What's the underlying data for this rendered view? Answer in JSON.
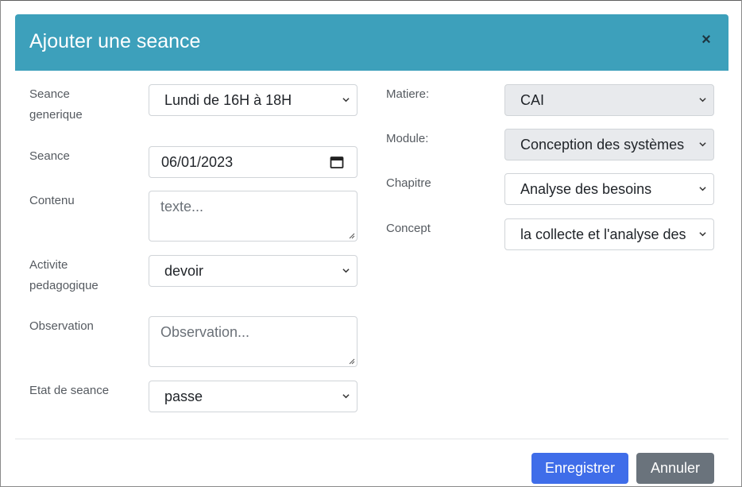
{
  "modal": {
    "title": "Ajouter une seance",
    "close": "×"
  },
  "left": {
    "seance_generique": {
      "label_line1": "Seance",
      "label_line2": "generique",
      "value": "Lundi de 16H à 18H"
    },
    "seance": {
      "label": "Seance",
      "value": "06/01/2023"
    },
    "contenu": {
      "label": "Contenu",
      "placeholder": "texte..."
    },
    "activite": {
      "label_line1": "Activite",
      "label_line2": "pedagogique",
      "value": "devoir"
    },
    "observation": {
      "label": "Observation",
      "placeholder": "Observation..."
    },
    "etat": {
      "label": "Etat de seance",
      "value": "passe"
    }
  },
  "right": {
    "matiere": {
      "label": "Matiere:",
      "value": "CAI"
    },
    "module": {
      "label": "Module:",
      "value": "Conception des systèmes"
    },
    "chapitre": {
      "label": "Chapitre",
      "value": "Analyse des besoins"
    },
    "concept": {
      "label": "Concept",
      "value": "la collecte et l'analyse des"
    }
  },
  "footer": {
    "save_label": "Enregistrer",
    "cancel_label": "Annuler"
  },
  "colors": {
    "header": "#3da0bb",
    "primary": "#3f6de9",
    "secondary": "#6a737c"
  },
  "icons": {
    "chevron": "chevron-down-icon",
    "calendar": "calendar-icon",
    "close": "close-icon",
    "resize": "resize-handle-icon"
  }
}
